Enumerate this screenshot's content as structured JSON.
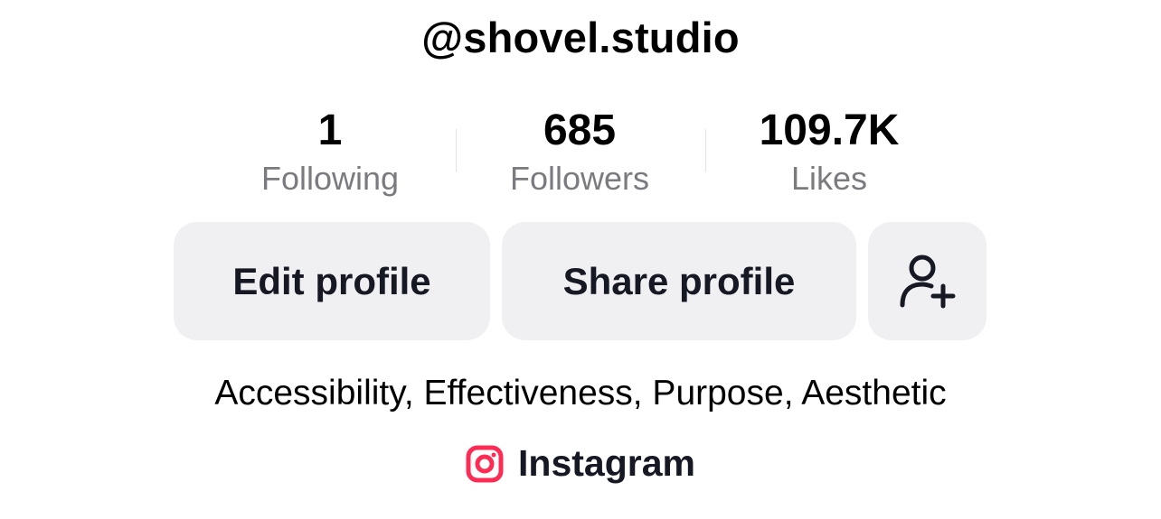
{
  "profile": {
    "username": "@shovel.studio",
    "bio": "Accessibility, Effectiveness, Purpose, Aesthetic"
  },
  "stats": {
    "following": {
      "value": "1",
      "label": "Following"
    },
    "followers": {
      "value": "685",
      "label": "Followers"
    },
    "likes": {
      "value": "109.7K",
      "label": "Likes"
    }
  },
  "buttons": {
    "edit_profile": "Edit profile",
    "share_profile": "Share profile",
    "add_friends_icon": "person-add-icon"
  },
  "link": {
    "icon": "instagram-icon",
    "label": "Instagram",
    "icon_color": "#fe2c55"
  }
}
